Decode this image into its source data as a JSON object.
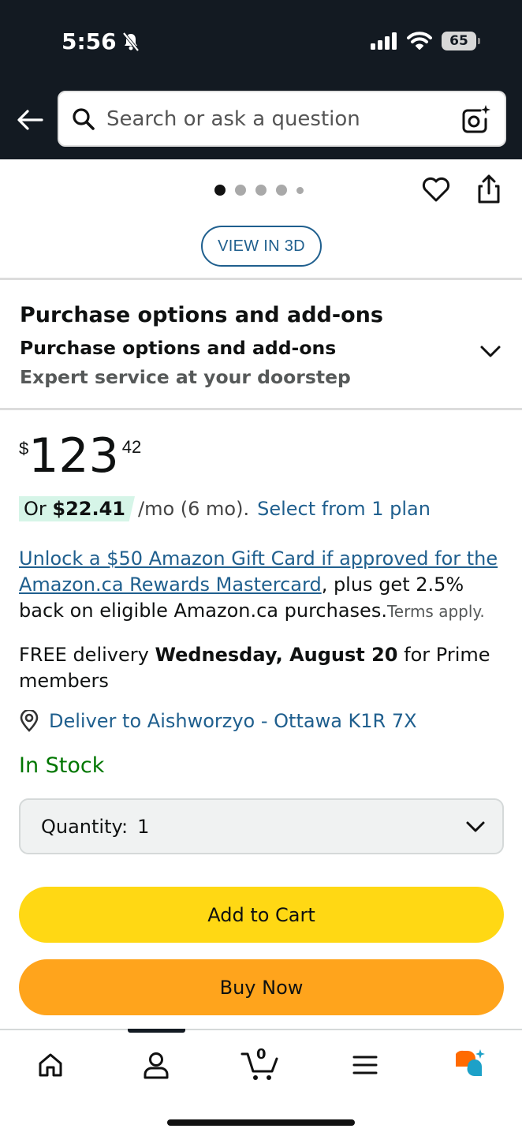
{
  "status_bar": {
    "time": "5:56",
    "battery": "65"
  },
  "search": {
    "placeholder": "Search or ask a question"
  },
  "product_images": {
    "dot_count": 5,
    "active_dot": 0,
    "view_3d_label": "VIEW IN 3D"
  },
  "purchase_options": {
    "title": "Purchase options and add-ons",
    "subtitle": "Purchase options and add-ons",
    "description": "Expert service at your doorstep"
  },
  "price": {
    "symbol": "$",
    "whole": "123",
    "fraction": "42"
  },
  "plan": {
    "prefix": "Or ",
    "amount": "$22.41",
    "term": "/mo (6 mo).",
    "link": "Select from 1 plan"
  },
  "promo": {
    "link_text": "Unlock a $50 Amazon Gift Card if approved for the Amazon.ca Rewards Mastercard",
    "rest_text": ", plus get 2.5% back on eligible Amazon.ca purchases.",
    "terms": "Terms apply."
  },
  "delivery": {
    "prefix": "FREE delivery ",
    "date": "Wednesday, August 20",
    "suffix": " for Prime members"
  },
  "deliver_to": "Deliver to Aishworzyo - Ottawa K1R 7X",
  "stock_status": "In Stock",
  "quantity": {
    "label": "Quantity:",
    "value": "1"
  },
  "buttons": {
    "add_to_cart": "Add to Cart",
    "buy_now": "Buy Now"
  },
  "nav": {
    "cart_count": "0",
    "items": [
      "home-icon",
      "account-icon",
      "cart-icon",
      "menu-icon",
      "rufus-icon"
    ]
  },
  "colors": {
    "header_bg": "#131a22",
    "link": "#1f5f8e",
    "in_stock": "#007600",
    "add_to_cart": "#ffd814",
    "buy_now": "#ffa41c",
    "plan_badge": "#d6f5e8"
  }
}
